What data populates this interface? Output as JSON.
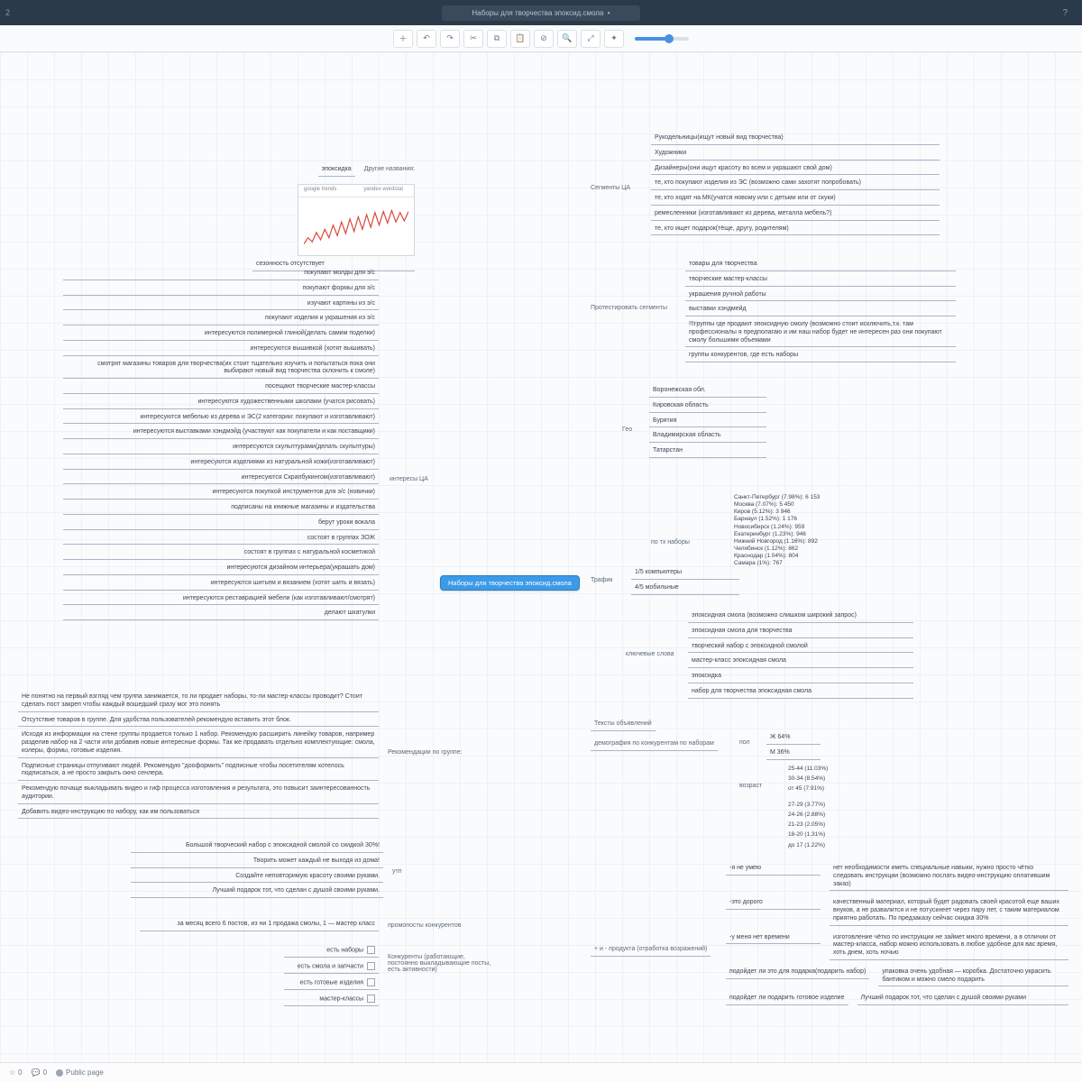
{
  "header": {
    "title": "Наборы для творчества эпоксид.смола  •",
    "left_num": "2",
    "help": "?"
  },
  "toolbar": {
    "icons": [
      "plus",
      "undo",
      "redo",
      "cut",
      "copy",
      "paste",
      "link",
      "search",
      "expand",
      "collapse"
    ]
  },
  "root": {
    "label": "Наборы для творчества эпоксид.смола"
  },
  "left": {
    "other_names": {
      "label": "Другие названия:",
      "children": [
        "эпоксидка"
      ],
      "caption": "сезонность отсутствует",
      "thumb_tabs": [
        "google trends",
        "yandex wordstat"
      ]
    },
    "interests": {
      "label": "интересы ЦА",
      "items": [
        "покупают молды для э/с",
        "покупают формы для э/с",
        "изучают картины из э/с",
        "покупают изделия и украшения из э/с",
        "интересуются полимерной глиной(делать самим поделки)",
        "интересуются вышивкой (хотят вышивать)",
        "смотрят магазины товаров для творчества(их стоит тщательно изучить и попытаться пока они выбирают новый вид творчества склонить к смоле)",
        "посещают творческие мастер-классы",
        "интересуются художественными школами (учатся рисовать)",
        "интересуются мебелью из дерева и ЭС(2 категории: покупают и изготавливают)",
        "интересуются выставками хэндмэйд (участвуют как покупатели и как поставщики)",
        "интересуются скульптурами(делать скульптуры)",
        "интересуются изделиями из натуральной кожи(изготавливают)",
        "интересуются Скрапбукингом(изготавливают)",
        "интересуются покупкой инструментов для э/с (новички)",
        "подписаны на книжные магазины и издательства",
        "берут уроки вокала",
        "состоят в группах ЗОЖ",
        "состоят в группах с натуральной косметикой",
        "интересуются дизайном интерьера(украшать дом)",
        "интересуются шитьем и вязанием (хотят шить и вязать)",
        "интересуются реставрацией мебели (как изготавливают/смотрят)",
        "делают шкатулки"
      ]
    },
    "group_recs": {
      "label": "Рекомендации по группе:",
      "items": [
        "Не понятно на первый взгляд чем группа занимается, то ли продает наборы, то-ли мастер-классы проводит? Стоит сделать пост закреп чтобы каждый вошедший сразу мог это понять",
        "Отсутствие товаров в группе. Для удобства пользователей рекомендую вставить этот блок.",
        "Исходя из информации на стене группы продается только 1 набор. Рекомендую расширить линейку товаров, например разделив набор на 2 части или добавив новые интересные формы. Так же продавать отдельно комплектующие: смола, колеры, формы, готовые изделия.",
        "Подписные страницы отпугивают людей. Рекомендую \"дооформить\" подписные чтобы посетителям хотелось подписаться, а не просто закрыть окно сенлера.",
        "Рекомендую почаще выкладывать видео и гиф процесса изготовления и результата, это повысит заинтересованность аудитории.",
        "Добавить видео-инструкцию по набору, как им пользоваться"
      ]
    },
    "utp": {
      "label": "утп",
      "items": [
        "Большой творческий набор с эпоксидной смолой со скидкой 30%!",
        "Творить может каждый не выходя из дома!",
        "Создайте неповторимую красоту своими руками.",
        "Лучший подарок тот, что сделан с душой своими руками."
      ]
    },
    "promoposts": {
      "label": "промопосты конкурентов",
      "items": [
        "за месяц всего 6 постов, из ни 1 продажа смолы, 1 — мастер класс"
      ]
    },
    "competitors": {
      "label": "Конкуренты (работающие, постоянно выкладывающие посты, есть активности)",
      "items": [
        "есть наборы",
        "есть смола и запчасти",
        "есть готовые изделия",
        "мастер-классы"
      ]
    }
  },
  "right": {
    "segments": {
      "label": "Сегменты ЦА",
      "items": [
        "Рукодельницы(ищут новый вид творчества)",
        "Художники",
        "Дизайнеры(они ищут красоту во всем и украшают свой дом)",
        "те, кто покупают изделия из ЭС (возможно сами захотят попробовать)",
        "те, кто ходят на МК(учатся новому или с детьми или от скуки)",
        "ремесленники (изготавливают из дерева, металла мебель?)",
        "те, кто ищет подарок(тёще, другу, родителям)"
      ]
    },
    "test_segments": {
      "label": "Протестировать сегменты",
      "items": [
        "товары для творчества",
        "творческие мастер-классы",
        "украшения ручной работы",
        "выставки хэндмейд",
        "!!!группы где продают эпоксидную смолу (возможно стоит исключить,т.к. там профессионалы я предполагаю и им наш набор будет не интересен раз они покупают смолу большими объемами",
        "группы конкурентов, где есть наборы"
      ]
    },
    "geo": {
      "label": "Гео",
      "items": [
        "Воронежская обл.",
        "Кировская область",
        "Бурятия",
        "Владимирская область",
        "Татарстан"
      ],
      "sub_label": "по тх наборы",
      "cities": [
        "Санкт-Петербург (7.98%): 6 153",
        "Москва (7.07%): 5 450",
        "Киров (5.12%): 3 946",
        "Барнаул (1.52%): 1 176",
        "Новосибирск (1.24%): 959",
        "Екатеринбург (1.23%): 946",
        "Нижний Новгород (1.16%): 892",
        "Челябинск (1.12%): 862",
        "Краснодар (1.04%): 804",
        "Самара (1%): 767"
      ]
    },
    "traffic": {
      "label": "Трафик",
      "items": [
        "1/5 компьютеры",
        "4/5 мобильные"
      ]
    },
    "keywords": {
      "label": "ключевые слова",
      "items": [
        "эпоксидная смола (возможно слишком широкий запрос)",
        "эпоксидная смола для творчества",
        "творческий набор с эпоксидной смолой",
        "мастер-класс эпоксидная смола",
        "эпоксидка",
        "набор для творчества эпоксидная смола"
      ]
    },
    "ad_texts": {
      "label": "Тексты объявлений"
    },
    "demography": {
      "label": "демография по конкурентам по наборам",
      "gender": {
        "label": "пол",
        "items": [
          "Ж 64%",
          "М 36%"
        ]
      },
      "age": {
        "label": "возраст",
        "main": [
          "25-44 (11.03%)",
          "30-34 (8.54%)",
          "от 45 (7.91%)"
        ],
        "extra": [
          "27-29 (3.77%)",
          "24-26 (2.88%)",
          "21-23 (2.05%)",
          "18-20 (1.31%)",
          "до 17 (1.22%)"
        ]
      }
    },
    "objections": {
      "label": "+ и - продукта (отработка возражений)",
      "items": [
        {
          "k": "-я не умею",
          "v": "нет необходимости иметь специальные навыки, нужно просто чётко следовать инструкции (возможно послать видео-инструкцию оплатившим заказ)"
        },
        {
          "k": "-это дорого",
          "v": "качественный материал, который будет радовать своей красотой еще ваших внуков, а не развалится и не потускнеет через пару лет, с таким материалом приятно работать. По предзаказу сейчас скидка 30%"
        },
        {
          "k": "-у меня нет времени",
          "v": "изготовление чётко по инструкции не займет много времени, а в отличии от мастер-класса, набор можно использовать в любое удобное для вас время, хоть днем, хоть ночью"
        },
        {
          "k": "подойдет ли это для подарка(подарить набор)",
          "v": "упаковка очень удобная — коробка. Достаточно украсить бантиком и можно смело подарить"
        },
        {
          "k": "подойдет ли подарить готовое изделие",
          "v": "Лучший подарок тот, что сделан с душой своими руками"
        }
      ]
    }
  },
  "footer": {
    "counts": [
      "0",
      "0"
    ],
    "public": "Public page"
  }
}
